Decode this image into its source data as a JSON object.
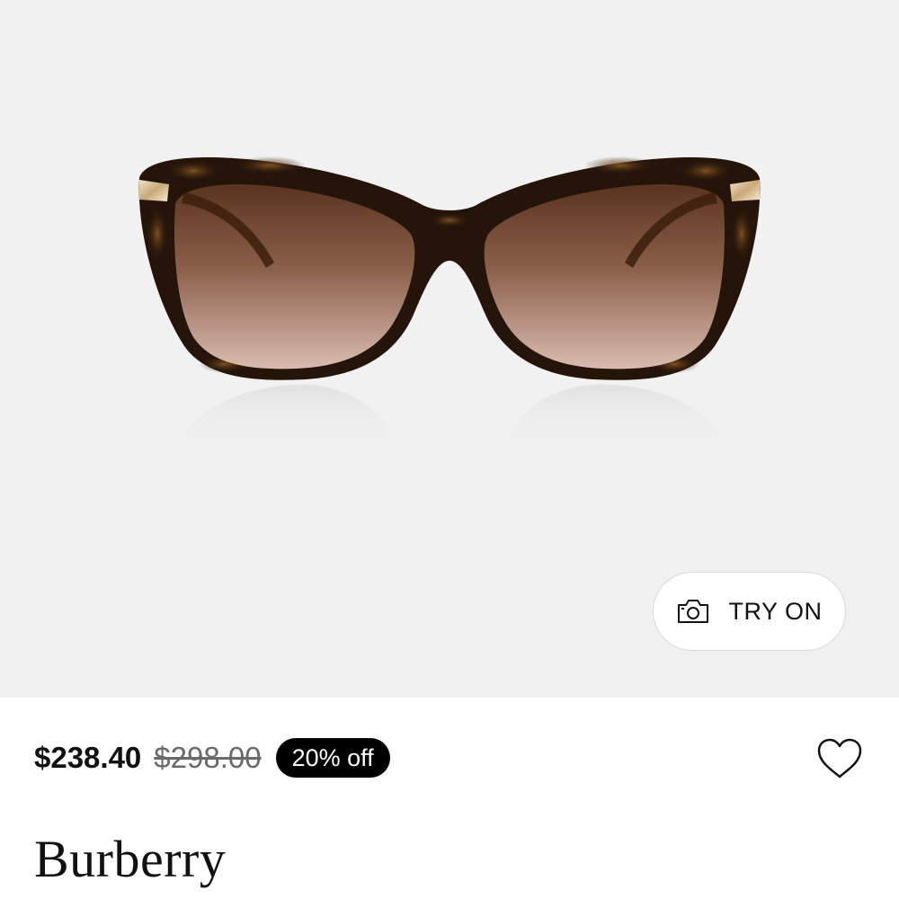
{
  "product": {
    "image_alt": "Tortoiseshell cat-eye sunglasses with gradient brown lenses"
  },
  "try_on": {
    "label": "TRY ON",
    "icon": "camera-icon"
  },
  "pricing": {
    "current": "$238.40",
    "original": "$298.00",
    "discount": "20% off"
  },
  "wishlist": {
    "icon": "heart-icon"
  },
  "brand": {
    "name": "Burberry"
  },
  "colors": {
    "hero_background": "#f1f1f1",
    "badge_background": "#000000",
    "strike_price": "#6a6a6a"
  }
}
